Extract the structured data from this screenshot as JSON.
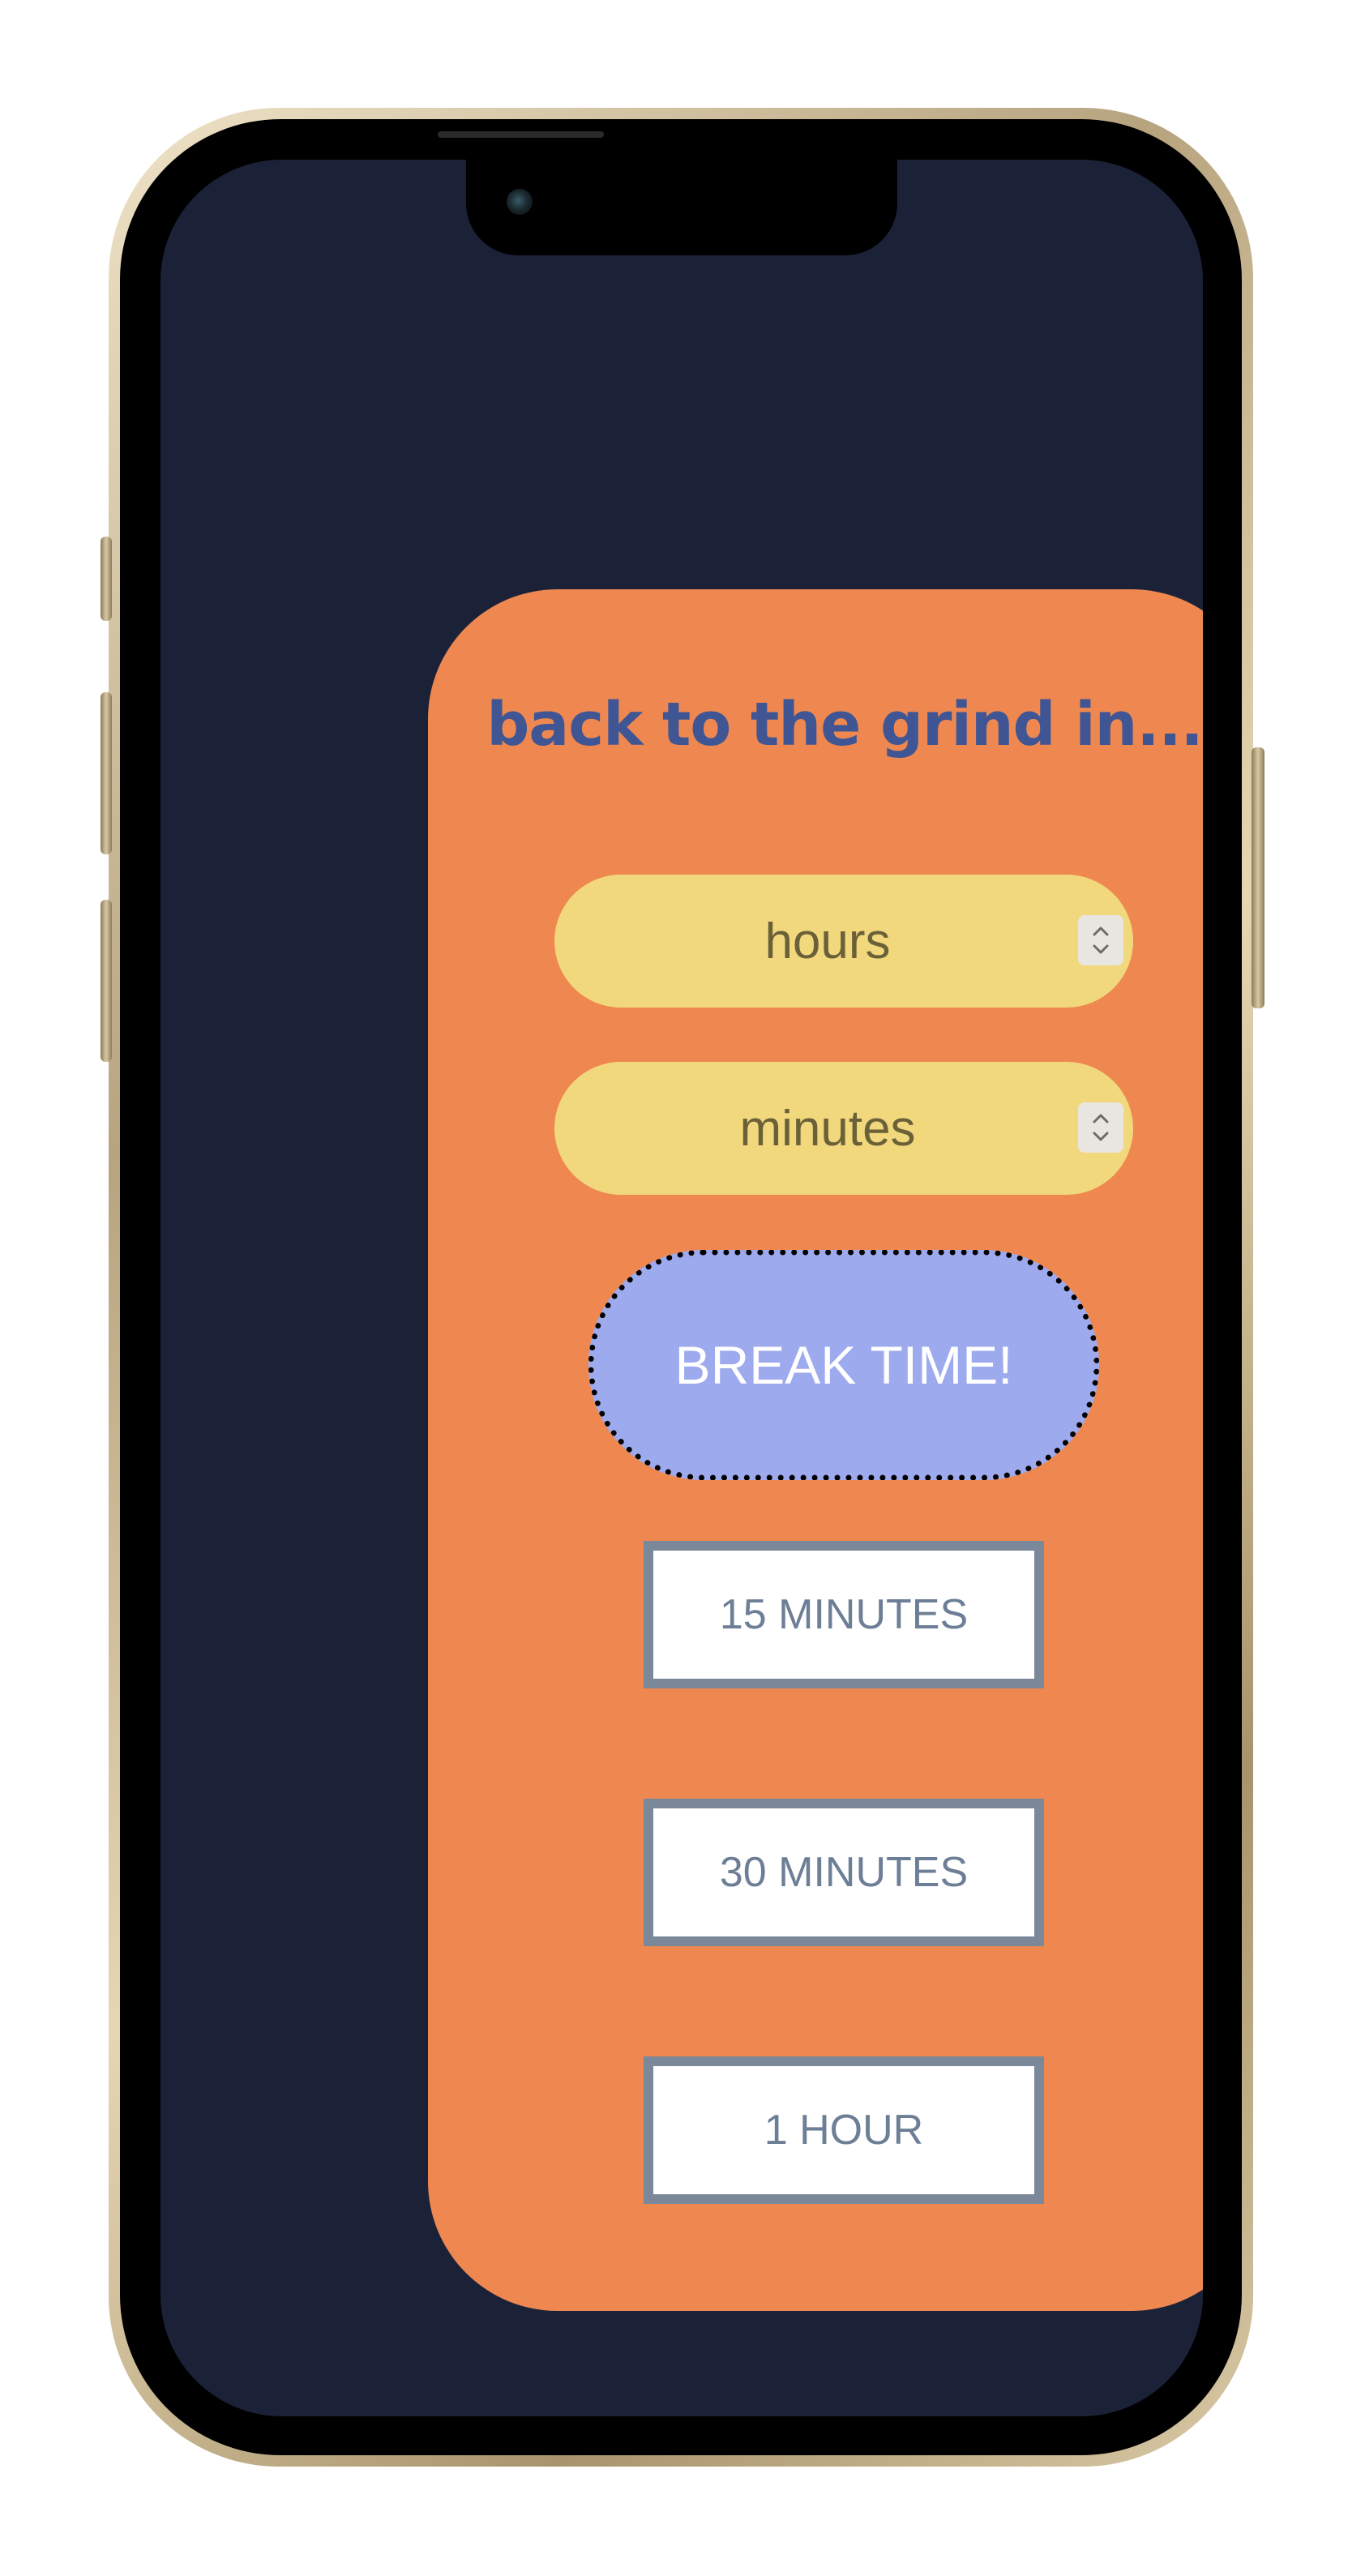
{
  "app": {
    "title": "back to the grind in..."
  },
  "inputs": {
    "hours": {
      "placeholder": "hours",
      "value": ""
    },
    "minutes": {
      "placeholder": "minutes",
      "value": ""
    }
  },
  "buttons": {
    "break": "BREAK TIME!",
    "options": [
      "15 MINUTES",
      "30 MINUTES",
      "1 HOUR"
    ]
  },
  "colors": {
    "screen_background": "#1b2238",
    "card_background": "#ee8850",
    "title_text": "#3f5594",
    "input_background": "#f2d87d",
    "break_button_background": "#9eaaee",
    "option_button_border": "#7a8899",
    "option_button_text": "#6d7f96"
  },
  "icons": {
    "stepper": "chevron-up-down-icon"
  }
}
